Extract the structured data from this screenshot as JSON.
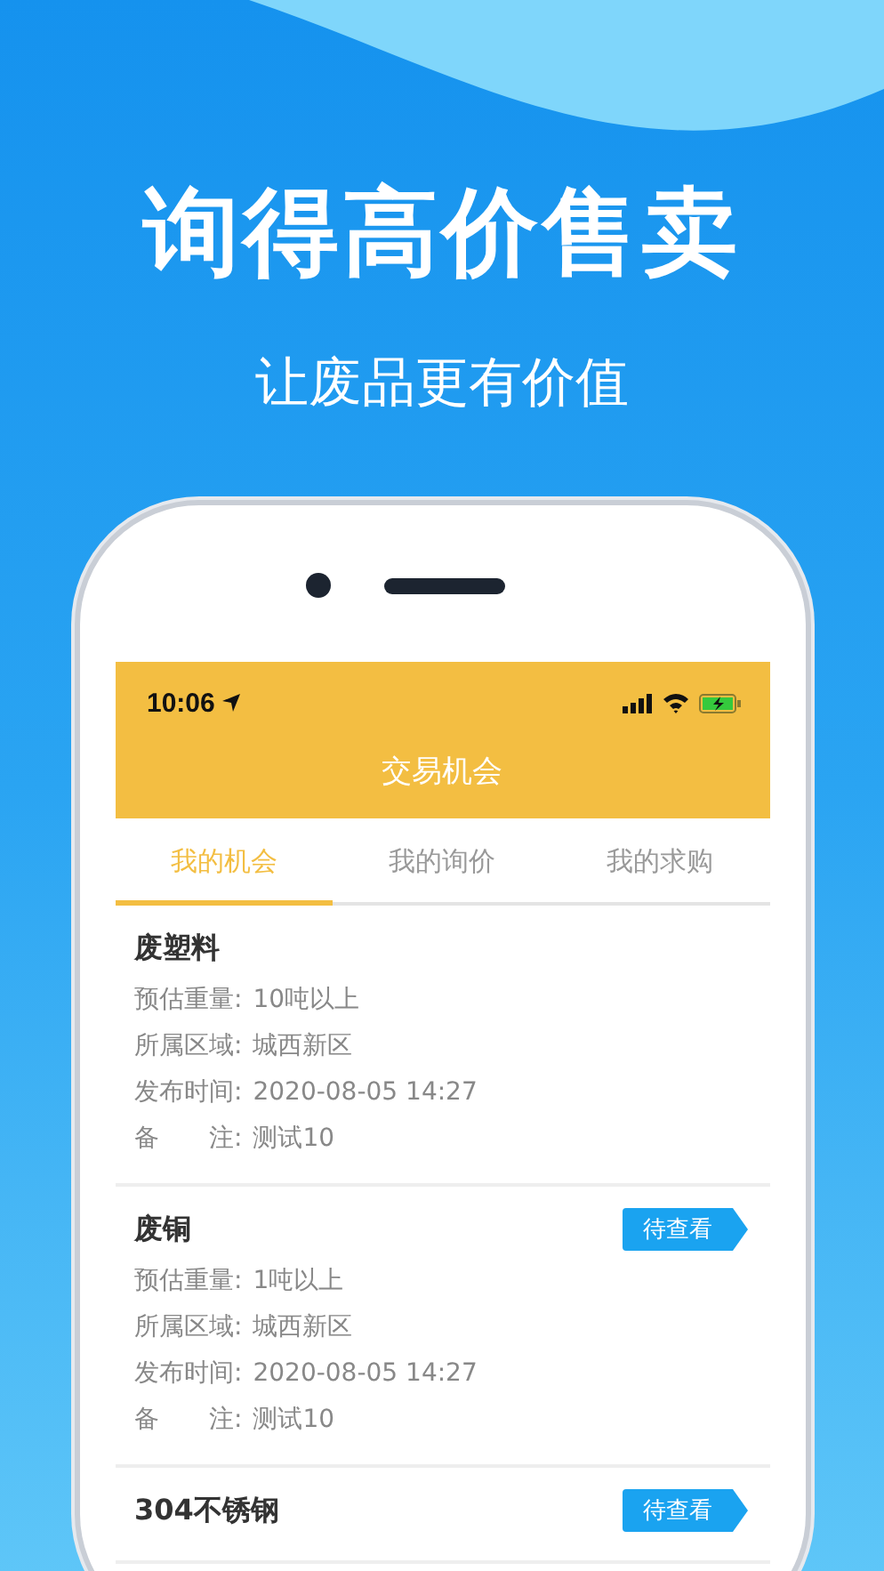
{
  "headline": "询得高价售卖",
  "subtitle": "让废品更有价值",
  "status_bar": {
    "time": "10:06"
  },
  "header": {
    "title": "交易机会"
  },
  "tabs": [
    {
      "label": "我的机会",
      "selected": true
    },
    {
      "label": "我的询价",
      "selected": false
    },
    {
      "label": "我的求购",
      "selected": false
    }
  ],
  "items": [
    {
      "title": "废塑料",
      "fields": [
        {
          "label": "预估重量:",
          "value": "10吨以上"
        },
        {
          "label": "所属区域:",
          "value": "城西新区"
        },
        {
          "label": "发布时间:",
          "value": "2020-08-05 14:27"
        },
        {
          "label": "备　　注:",
          "value": "测试10"
        }
      ]
    },
    {
      "title": "废铜",
      "badge": "待查看",
      "fields": [
        {
          "label": "预估重量:",
          "value": "1吨以上"
        },
        {
          "label": "所属区域:",
          "value": "城西新区"
        },
        {
          "label": "发布时间:",
          "value": "2020-08-05 14:27"
        },
        {
          "label": "备　　注:",
          "value": "测试10"
        }
      ]
    },
    {
      "title": "304不锈钢",
      "badge": "待查看"
    }
  ]
}
